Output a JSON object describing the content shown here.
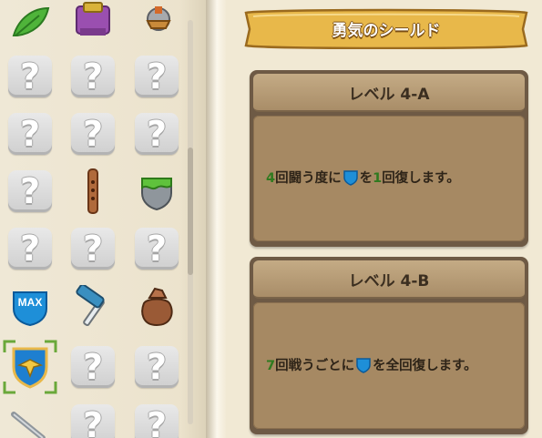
{
  "detail": {
    "title": "勇気のシールド",
    "levels": [
      {
        "label": "レベル 4-A",
        "num": "4",
        "text_a": "回闘う度に",
        "text_b": "を",
        "num2": "1",
        "text_c": "回復します。"
      },
      {
        "label": "レベル 4-B",
        "num": "7",
        "text_a": "回戦うごとに",
        "text_b": "を全回復します。"
      }
    ]
  },
  "inventory": {
    "max_badge": "MAX",
    "unknown_glyph": "?",
    "slots": [
      [
        "leaf-icon",
        "backpack-icon",
        "helmet-icon"
      ],
      [
        "unknown",
        "unknown",
        "unknown"
      ],
      [
        "unknown",
        "unknown",
        "unknown"
      ],
      [
        "unknown",
        "flute-icon",
        "slime-shield-icon"
      ],
      [
        "unknown",
        "unknown",
        "unknown"
      ],
      [
        "max-shield-icon",
        "hammer-icon",
        "sack-icon"
      ],
      [
        "courage-shield-icon",
        "unknown",
        "unknown"
      ],
      [
        "sword-icon",
        "unknown",
        "unknown"
      ]
    ],
    "selected_item": "courage-shield-icon"
  },
  "colors": {
    "number_green": "#2f7a1f",
    "panel_dark": "#6e5a45",
    "panel_body": "#a68963",
    "banner_gold": "#e8b84a",
    "shield_blue": "#1e8fd8"
  }
}
